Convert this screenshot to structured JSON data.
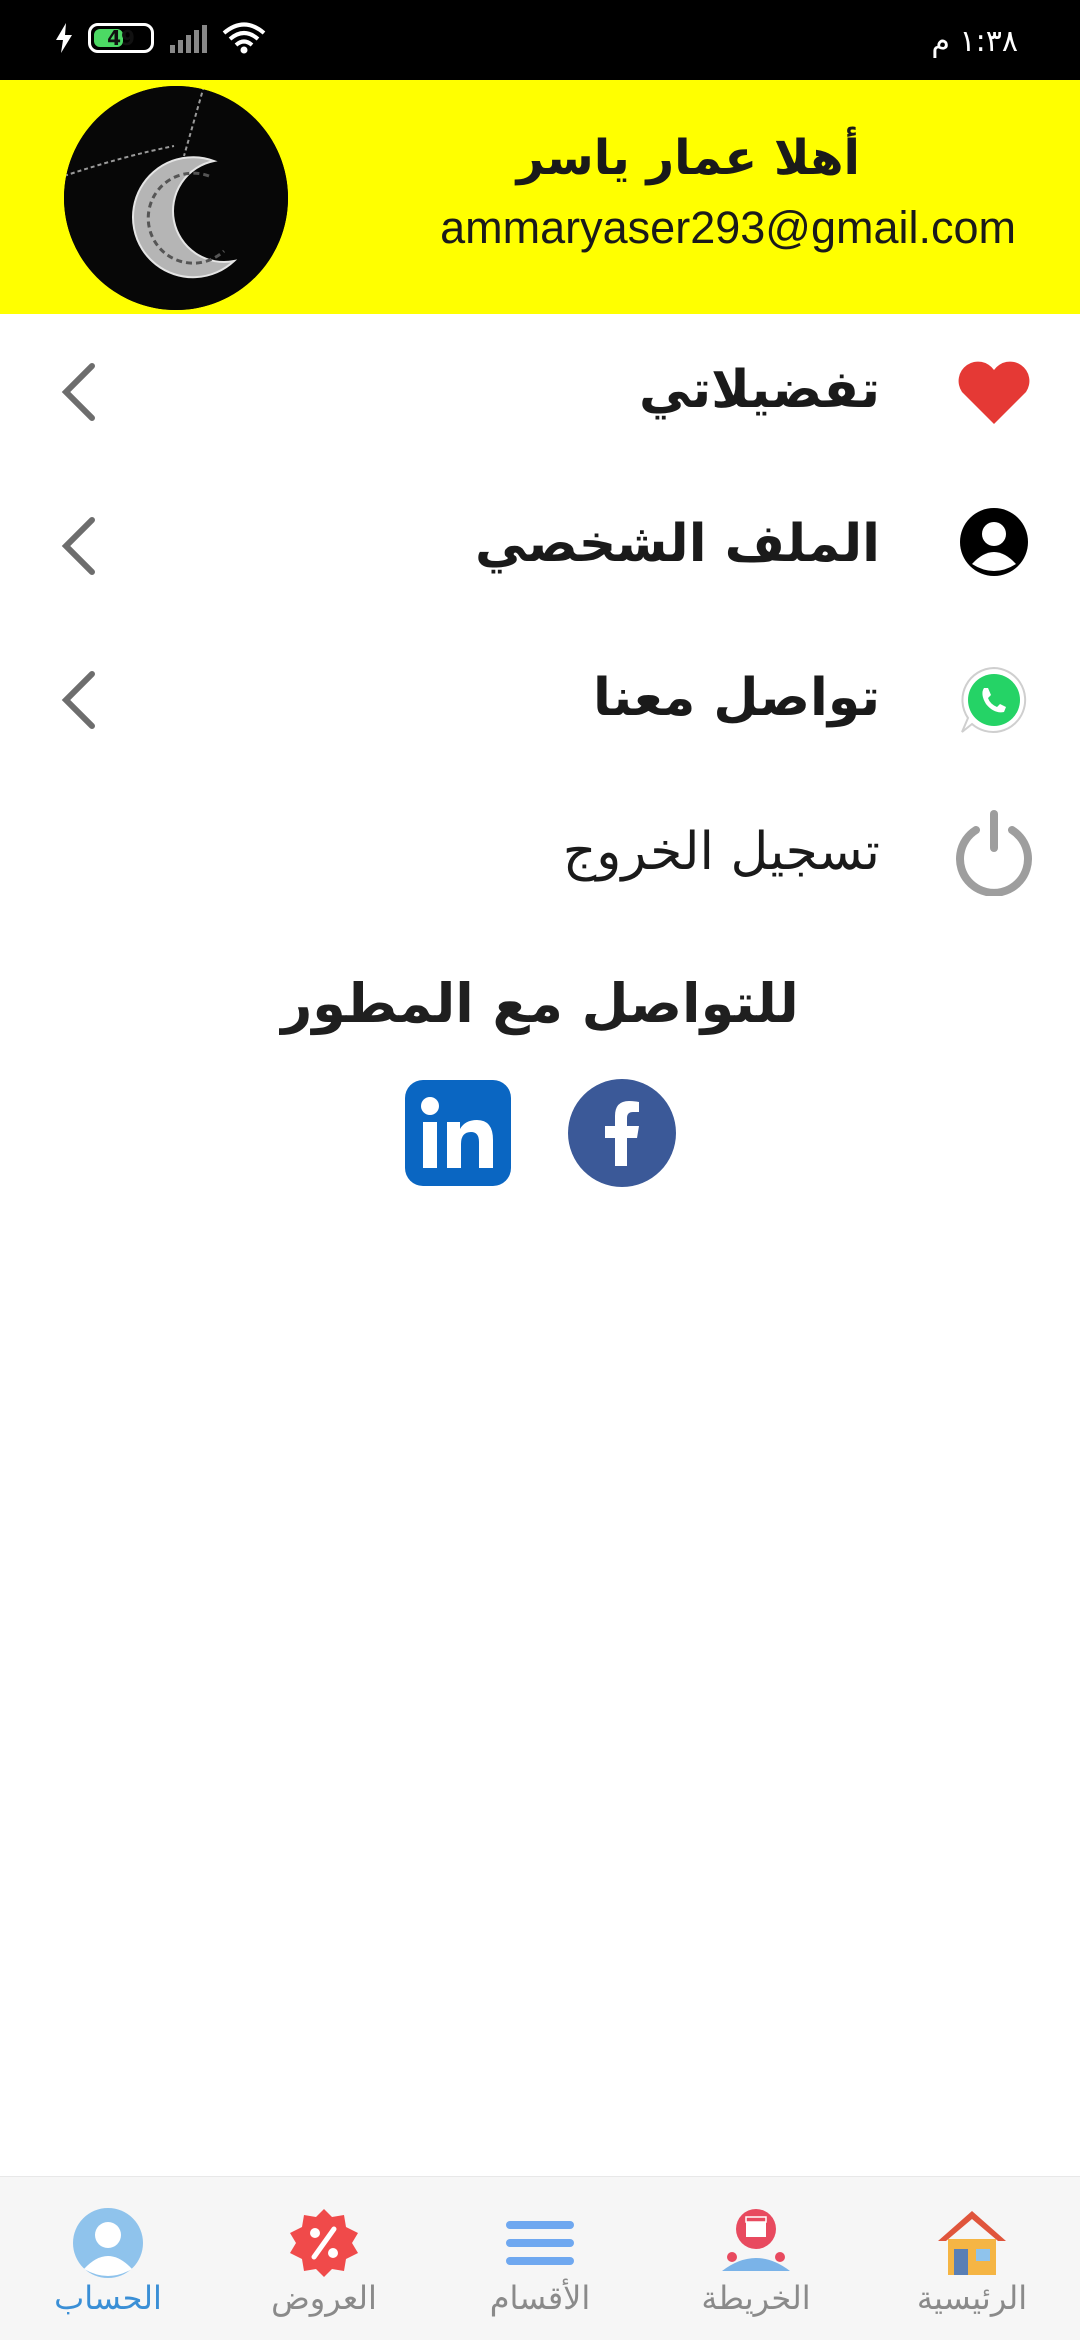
{
  "status_bar": {
    "battery": "49",
    "time": "١:٣٨ م"
  },
  "header": {
    "greeting": "أهلا عمار ياسر",
    "email": "ammaryaser293@gmail.com"
  },
  "menu": {
    "items": [
      {
        "label": "تفضيلاتي",
        "icon": "heart-icon"
      },
      {
        "label": "الملف الشخصي",
        "icon": "user-circle-icon"
      },
      {
        "label": "تواصل معنا",
        "icon": "whatsapp-icon"
      },
      {
        "label": "تسجيل الخروج",
        "icon": "power-icon"
      }
    ]
  },
  "developer": {
    "title": "للتواصل مع المطور",
    "links": [
      "linkedin-icon",
      "facebook-icon"
    ]
  },
  "bottom_nav": {
    "items": [
      {
        "label": "الحساب",
        "icon": "account-icon",
        "active": true
      },
      {
        "label": "العروض",
        "icon": "offers-percent-icon",
        "active": false
      },
      {
        "label": "الأقسام",
        "icon": "menu-lines-icon",
        "active": false
      },
      {
        "label": "الخريطة",
        "icon": "map-store-icon",
        "active": false
      },
      {
        "label": "الرئيسية",
        "icon": "home-icon",
        "active": false
      }
    ]
  },
  "colors": {
    "header_bg": "#ffff00",
    "accent": "#3a8fd6",
    "heart": "#e53935",
    "whatsapp": "#25d366",
    "facebook": "#3b5998",
    "linkedin": "#0a66c2"
  }
}
